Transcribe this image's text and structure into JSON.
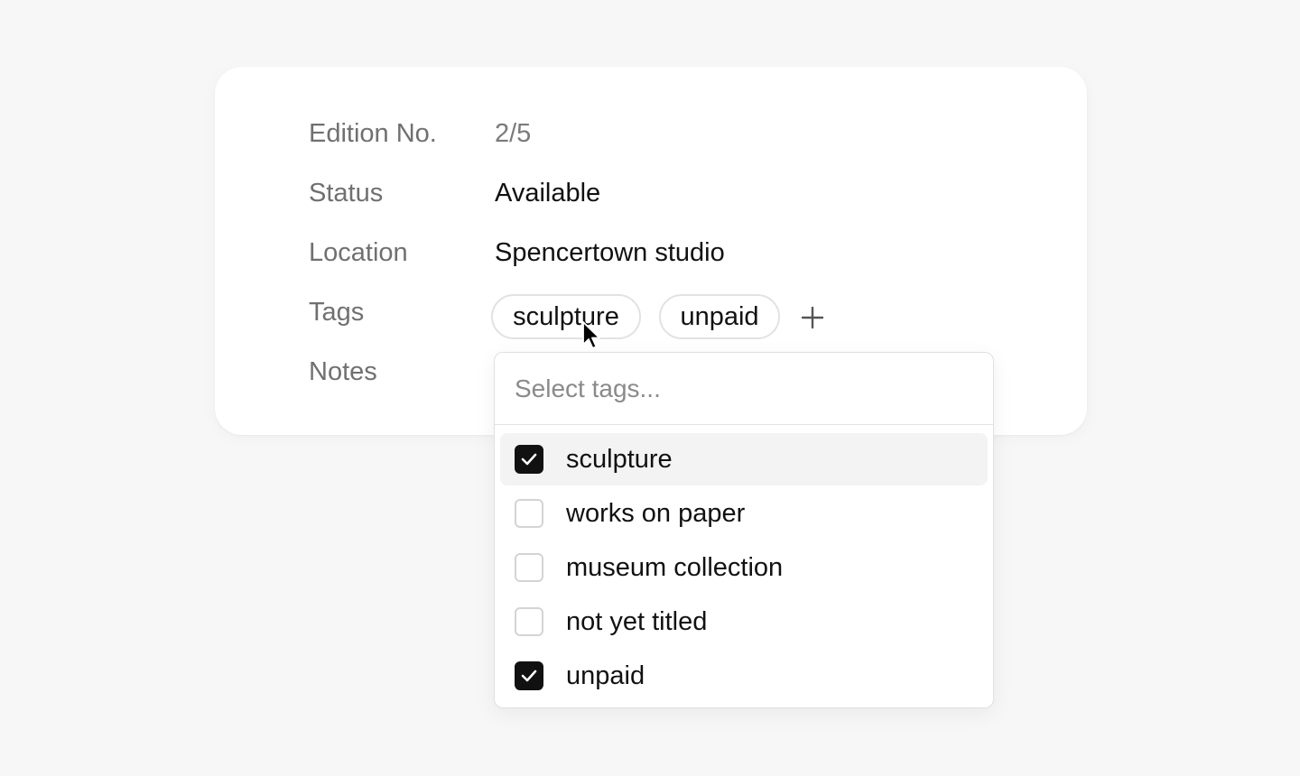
{
  "fields": {
    "edition": {
      "label": "Edition No.",
      "value": "2/5"
    },
    "status": {
      "label": "Status",
      "value": "Available"
    },
    "location": {
      "label": "Location",
      "value": "Spencertown studio"
    },
    "tags": {
      "label": "Tags"
    },
    "notes": {
      "label": "Notes"
    }
  },
  "tag_chips": [
    "sculpture",
    "unpaid"
  ],
  "add_tag_icon": "plus-icon",
  "tag_dropdown": {
    "search_placeholder": "Select tags...",
    "options": [
      {
        "label": "sculpture",
        "checked": true,
        "highlighted": true
      },
      {
        "label": "works on paper",
        "checked": false
      },
      {
        "label": "museum collection",
        "checked": false
      },
      {
        "label": "not yet titled",
        "checked": false
      },
      {
        "label": "unpaid",
        "checked": true
      }
    ]
  },
  "colors": {
    "background": "#f7f7f7",
    "card": "#ffffff",
    "label_text": "#707070",
    "checkbox_checked": "#111111"
  }
}
